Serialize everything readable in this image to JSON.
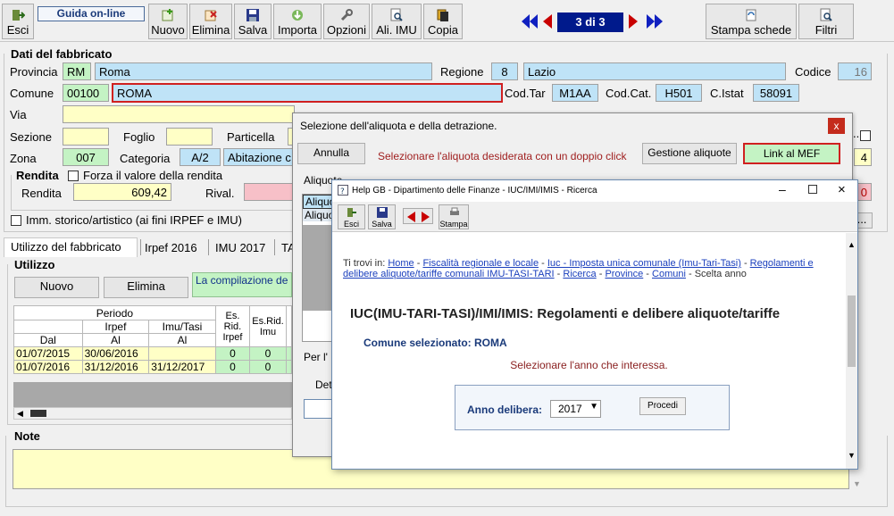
{
  "toolbar": {
    "esci": "Esci",
    "guida": "Guida on-line",
    "nuovo": "Nuovo",
    "elimina": "Elimina",
    "salva": "Salva",
    "importa": "Importa",
    "opzioni": "Opzioni",
    "ali_imu": "Ali. IMU",
    "copia": "Copia",
    "record_counter": "3 di 3",
    "stampa_schede": "Stampa schede",
    "filtri": "Filtri"
  },
  "dati": {
    "title": "Dati del fabbricato",
    "provincia_label": "Provincia",
    "provincia_code": "RM",
    "provincia_name": "Roma",
    "regione_label": "Regione",
    "regione_code": "8",
    "regione_name": "Lazio",
    "codice_label": "Codice",
    "codice": "16",
    "comune_label": "Comune",
    "comune_cap": "00100",
    "comune_name": "ROMA",
    "codtar_label": "Cod.Tar",
    "codtar": "M1AA",
    "codcat_label": "Cod.Cat.",
    "codcat": "H501",
    "cistat_label": "C.Istat",
    "cistat": "58091",
    "via_label": "Via",
    "via": "",
    "sezione_label": "Sezione",
    "foglio_label": "Foglio",
    "particella_label": "Particella",
    "zona_label": "Zona",
    "zona": "007",
    "categoria_label": "Categoria",
    "categoria": "A/2",
    "categoria_desc": "Abitazione c",
    "right_value": "4",
    "rendita_title": "Rendita",
    "forza_label": "Forza il valore della rendita",
    "rendita_label": "Rendita",
    "rendita": "609,42",
    "rival_label": "Rival.",
    "rival_value": "0",
    "storico_label": "Imm. storico/artistico (ai fini IRPEF e IMU)"
  },
  "tabs": [
    "Utilizzo del fabbricato",
    "Irpef 2016",
    "IMU 2017",
    "TA"
  ],
  "utilizzo": {
    "title": "Utilizzo",
    "nuovo": "Nuovo",
    "elimina": "Elimina",
    "note_text": "La compilazione de",
    "headers": {
      "periodo": "Periodo",
      "irpef": "Irpef",
      "imu_tasi": "Imu/Tasi",
      "dal": "Dal",
      "al": "Al",
      "al2": "Al",
      "esrid_irpef": "Es. Rid. Irpef",
      "esrid_imu": "Es.Rid. Imu"
    },
    "rows": [
      {
        "dal": "01/07/2015",
        "irpef_al": "30/06/2016",
        "imu_al": "",
        "esrid_irpef": "0",
        "esrid_imu": "0"
      },
      {
        "dal": "01/07/2016",
        "irpef_al": "31/12/2016",
        "imu_al": "31/12/2017",
        "esrid_irpef": "0",
        "esrid_imu": "0"
      }
    ]
  },
  "note": {
    "title": "Note",
    "text": ""
  },
  "dialog1": {
    "title": "Selezione dell'aliquota e della detrazione.",
    "annulla": "Annulla",
    "message": "Selezionare l'aliquota desiderata con un doppio click",
    "gestione": "Gestione aliquote",
    "link_mef": "Link al MEF",
    "aliquote_label": "Aliquote",
    "row1": "Aliquo",
    "row2": "Aliquo",
    "per_label": "Per l'",
    "det_label": "Det"
  },
  "dialog2": {
    "title": "Help GB - Dipartimento delle Finanze - IUC/IMI/IMIS - Ricerca",
    "esci": "Esci",
    "salva": "Salva",
    "stampa": "Stampa",
    "breadcrumb_prefix": "Ti trovi in:",
    "crumbs": [
      "Home",
      "Fiscalità regionale e locale",
      "Iuc - Imposta unica comunale (Imu-Tari-Tasi)",
      "Regolamenti e delibere aliquote/tariffe comunali IMU-TASI-TARI",
      "Ricerca",
      "Province",
      "Comuni"
    ],
    "current_crumb": "- Scelta anno",
    "heading": "IUC(IMU-TARI-TASI)/IMI/IMIS: Regolamenti e delibere aliquote/tariffe",
    "comune": "Comune selezionato: ROMA",
    "instruction": "Selezionare l'anno che interessa.",
    "anno_label": "Anno delibera:",
    "anno_value": "2017",
    "procedi": "Procedi"
  },
  "colors": {
    "blue_field": "#bfe3f7",
    "green_field": "#c4f3c4",
    "yellow_field": "#ffffc6",
    "counter_bg": "#001a8c",
    "nav_red": "#c80000",
    "nav_blue": "#1020c0"
  }
}
